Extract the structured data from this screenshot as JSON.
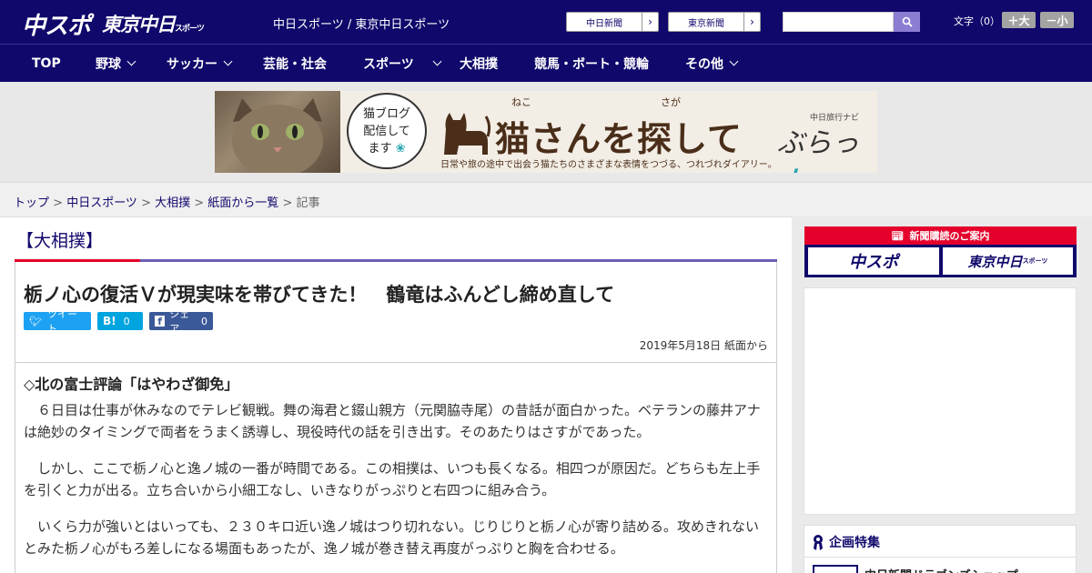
{
  "header": {
    "logo_chusupo": "中スポ",
    "logo_tokyo": "東京中日",
    "logo_tokyo_small": "スポーツ",
    "site_names": "中日スポーツ / 東京中日スポーツ",
    "buttons": [
      {
        "label": "中日新聞"
      },
      {
        "label": "東京新聞"
      }
    ],
    "search": {
      "placeholder": "",
      "icon": "search-icon"
    },
    "fontsize": {
      "label": "文字（0）",
      "bigger": "＋大",
      "smaller": "－小"
    }
  },
  "nav": {
    "items": [
      {
        "label": "TOP",
        "dropdown": false
      },
      {
        "label": "野球",
        "dropdown": true
      },
      {
        "label": "サッカー",
        "dropdown": true
      },
      {
        "label": "芸能・社会",
        "dropdown": false
      },
      {
        "label": "スポーツ",
        "dropdown": true
      },
      {
        "label": "大相撲",
        "dropdown": false
      },
      {
        "label": "競馬・ボート・競輪",
        "dropdown": false
      },
      {
        "label": "その他",
        "dropdown": true
      }
    ]
  },
  "banner": {
    "bubble_line1": "猫ブログ",
    "bubble_line2": "配信して",
    "bubble_line3": "ます",
    "ruby_neko": "ねこ",
    "ruby_sagashite": "さが",
    "title": "猫さんを探して",
    "navi_small": "中日旅行ナビ",
    "navi_big_a": "ぶらっ",
    "navi_big_b": "人",
    "subtitle": "日常や旅の途中で出会う猫たちのさまざまな表情をつづる、つれづれダイアリー。"
  },
  "breadcrumb": {
    "items": [
      "トップ",
      "中日スポーツ",
      "大相撲",
      "紙面から一覧"
    ],
    "current": "記事",
    "separator": " > "
  },
  "article": {
    "section": "【大相撲】",
    "title": "栃ノ心の復活Ｖが現実味を帯びてきた！　鶴竜はふんどし締め直して",
    "share": {
      "tweet": "ツイート",
      "hatena": "B!",
      "hatena_count": "0",
      "facebook": "シェア",
      "facebook_count": "0"
    },
    "date": "2019年5月18日 紙面から",
    "subhead": "◇北の富士評論「はやわざ御免」",
    "paragraphs": [
      "６日目は仕事が休みなのでテレビ観戦。舞の海君と錣山親方（元関脇寺尾）の昔話が面白かった。ベテランの藤井アナは絶妙のタイミングで両者をうまく誘導し、現役時代の話を引き出す。そのあたりはさすがであった。",
      "しかし、ここで栃ノ心と逸ノ城の一番が時間である。この相撲は、いつも長くなる。相四つが原因だ。どちらも左上手を引くと力が出る。立ち合いから小細工なし、いきなりがっぷりと右四つに組み合う。",
      "いくら力が強いとはいっても、２３０キロ近い逸ノ城はつり切れない。じりじりと栃ノ心が寄り詰める。攻めきれないとみた栃ノ心がもろ差しになる場面もあったが、逸ノ城が巻き替え再度がっぷりと胸を合わせる。"
    ]
  },
  "sidebar": {
    "ad_header": "新聞購読のご案内",
    "ad_logo1": "中スポ",
    "ad_logo2": "東京中日",
    "ad_logo2_small": "スポーツ",
    "feature_title": "企画特集",
    "feature_item": "中日新聞ドラゴンズショップ"
  },
  "colors": {
    "brand_navy": "#10086b",
    "accent_red": "#e4002b",
    "twitter": "#1da1f2",
    "hatena": "#00a4de",
    "facebook": "#3b5998"
  }
}
